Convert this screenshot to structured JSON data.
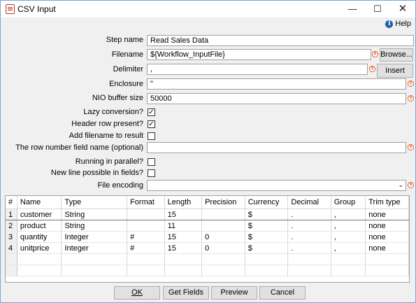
{
  "window": {
    "title": "CSV Input",
    "icon": "csv-input-icon"
  },
  "help": {
    "label": "Help"
  },
  "form": {
    "step_name": {
      "label": "Step name",
      "value": "Read Sales Data"
    },
    "filename": {
      "label": "Filename",
      "value": "${Workflow_InputFile}",
      "browse": "Browse..."
    },
    "delimiter": {
      "label": "Delimiter",
      "value": ",",
      "insert_tab": "Insert TAB"
    },
    "enclosure": {
      "label": "Enclosure",
      "value": "\""
    },
    "nio_buffer": {
      "label": "NIO buffer size",
      "value": "50000"
    },
    "lazy_conversion": {
      "label": "Lazy conversion?",
      "checked": true
    },
    "header_row": {
      "label": "Header row present?",
      "checked": true
    },
    "add_filename": {
      "label": "Add filename to result",
      "checked": false
    },
    "row_number_field": {
      "label": "The row number field name (optional)",
      "value": ""
    },
    "parallel": {
      "label": "Running in parallel?",
      "checked": false
    },
    "newline": {
      "label": "New line possible in fields?",
      "checked": false
    },
    "encoding": {
      "label": "File encoding",
      "value": ""
    }
  },
  "table": {
    "headers": [
      "#",
      "Name",
      "Type",
      "Format",
      "Length",
      "Precision",
      "Currency",
      "Decimal",
      "Group",
      "Trim type"
    ],
    "rows": [
      [
        "1",
        "customer",
        "String",
        "",
        "15",
        "",
        "$",
        ".",
        ",",
        "none"
      ],
      [
        "2",
        "product",
        "String",
        "",
        "11",
        "",
        "$",
        ".",
        ",",
        "none"
      ],
      [
        "3",
        "quantity",
        "Integer",
        "#",
        "15",
        "0",
        "$",
        ".",
        ",",
        "none"
      ],
      [
        "4",
        "unitprice",
        "Integer",
        "#",
        "15",
        "0",
        "$",
        ".",
        ",",
        "none"
      ]
    ]
  },
  "buttons": {
    "ok": "OK",
    "get_fields": "Get Fields",
    "preview": "Preview",
    "cancel": "Cancel"
  }
}
